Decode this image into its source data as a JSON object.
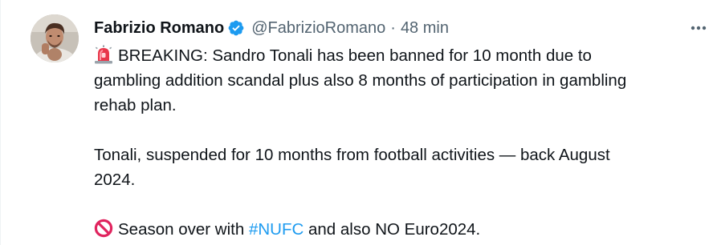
{
  "author": {
    "display_name": "Fabrizio Romano",
    "handle": "@FabrizioRomano",
    "separator": "·",
    "timestamp": "48 min",
    "verified": true
  },
  "icons": {
    "verified": "verified-badge-icon",
    "more": "more-dots-icon",
    "siren": "police-light-emoji-icon",
    "prohibited": "prohibited-emoji-icon"
  },
  "colors": {
    "accent": "#1d9bf0",
    "text": "#0f1419",
    "secondary_text": "#536471"
  },
  "tweet": {
    "line1": "BREAKING: Sandro Tonali has been banned for 10 month due to",
    "line2": "gambling addition scandal plus also 8 months of participation in gambling",
    "line3": "rehab plan.",
    "line4": "Tonali, suspended for 10 months from football activities — back August",
    "line5": "2024.",
    "line6_before": "Season over with ",
    "hashtag": "#NUFC",
    "line6_after": " and also NO Euro2024."
  }
}
